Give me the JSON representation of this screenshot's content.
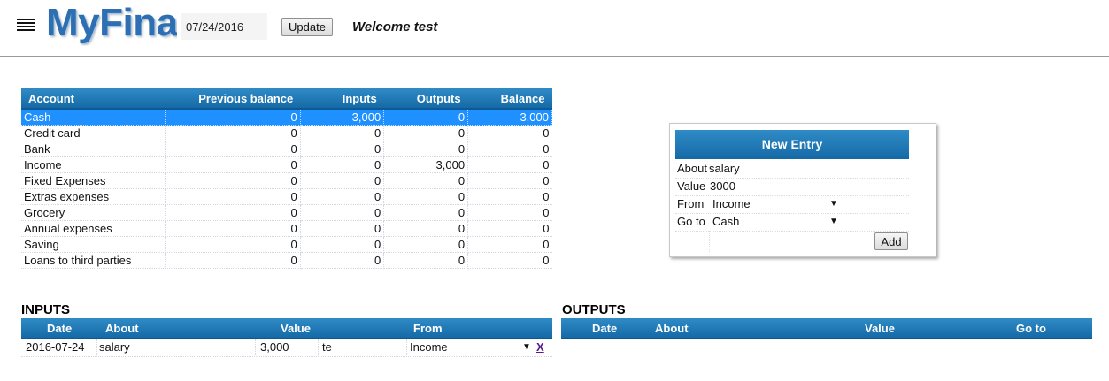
{
  "header": {
    "logo_text": "MyFinan",
    "date_value": "07/24/2016",
    "update_label": "Update",
    "welcome": "Welcome test"
  },
  "accounts": {
    "columns": [
      "Account",
      "Previous balance",
      "Inputs",
      "Outputs",
      "Balance"
    ],
    "rows": [
      {
        "name": "Cash",
        "previous": "0",
        "inputs": "3,000",
        "outputs": "0",
        "balance": "3,000",
        "selected": true
      },
      {
        "name": "Credit card",
        "previous": "0",
        "inputs": "0",
        "outputs": "0",
        "balance": "0"
      },
      {
        "name": "Bank",
        "previous": "0",
        "inputs": "0",
        "outputs": "0",
        "balance": "0"
      },
      {
        "name": "Income",
        "previous": "0",
        "inputs": "0",
        "outputs": "3,000",
        "balance": "0"
      },
      {
        "name": "Fixed Expenses",
        "previous": "0",
        "inputs": "0",
        "outputs": "0",
        "balance": "0"
      },
      {
        "name": "Extras expenses",
        "previous": "0",
        "inputs": "0",
        "outputs": "0",
        "balance": "0"
      },
      {
        "name": "Grocery",
        "previous": "0",
        "inputs": "0",
        "outputs": "0",
        "balance": "0"
      },
      {
        "name": "Annual expenses",
        "previous": "0",
        "inputs": "0",
        "outputs": "0",
        "balance": "0"
      },
      {
        "name": "Saving",
        "previous": "0",
        "inputs": "0",
        "outputs": "0",
        "balance": "0"
      },
      {
        "name": "Loans to third parties",
        "previous": "0",
        "inputs": "0",
        "outputs": "0",
        "balance": "0"
      }
    ]
  },
  "new_entry": {
    "title": "New Entry",
    "about_label": "About",
    "about_value": "salary",
    "value_label": "Value",
    "value_value": "3000",
    "from_label": "From",
    "from_value": "Income",
    "goto_label": "Go to",
    "goto_value": "Cash",
    "add_label": "Add"
  },
  "inputs": {
    "title": "INPUTS",
    "columns": {
      "date": "Date",
      "about": "About",
      "value": "Value",
      "from": "From"
    },
    "rows": [
      {
        "date": "2016-07-24",
        "about": "salary",
        "value": "3,000",
        "user": "te",
        "from": "Income",
        "delete": "X"
      }
    ]
  },
  "outputs": {
    "title": "OUTPUTS",
    "columns": {
      "date": "Date",
      "about": "About",
      "value": "Value",
      "goto": "Go to"
    }
  },
  "colors": {
    "header_blue": "#156aa6",
    "selected_row": "#1e90ff",
    "logo_blue": "#2d6fb2"
  },
  "icons": {
    "menu": "hamburger-menu-icon",
    "dropdown": "caret-down-icon"
  }
}
